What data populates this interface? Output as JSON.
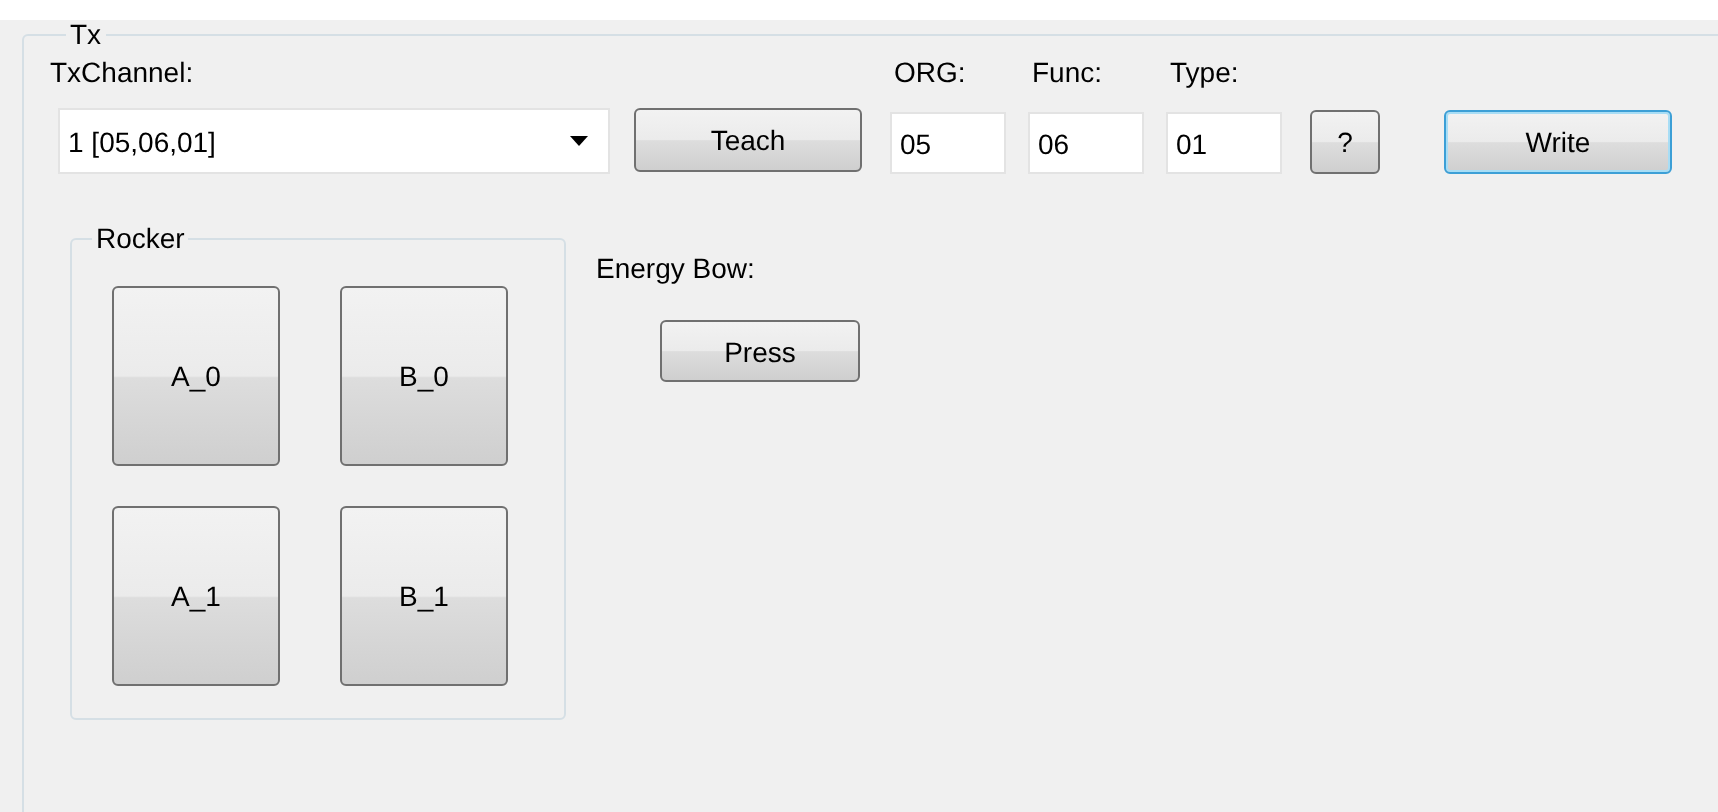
{
  "group": {
    "title": "Tx"
  },
  "channel": {
    "label": "TxChannel:",
    "value": "1 [05,06,01]"
  },
  "teach_button": "Teach",
  "fields": [
    {
      "label": "ORG:",
      "value": "05"
    },
    {
      "label": "Func:",
      "value": "06"
    },
    {
      "label": "Type:",
      "value": "01"
    }
  ],
  "help_button": "?",
  "write_button": {
    "label": "Write",
    "focused": true
  },
  "rocker": {
    "title": "Rocker",
    "buttons": [
      "A_0",
      "B_0",
      "A_1",
      "B_1"
    ]
  },
  "energy_bow": {
    "label": "Energy Bow:",
    "button": "Press"
  }
}
